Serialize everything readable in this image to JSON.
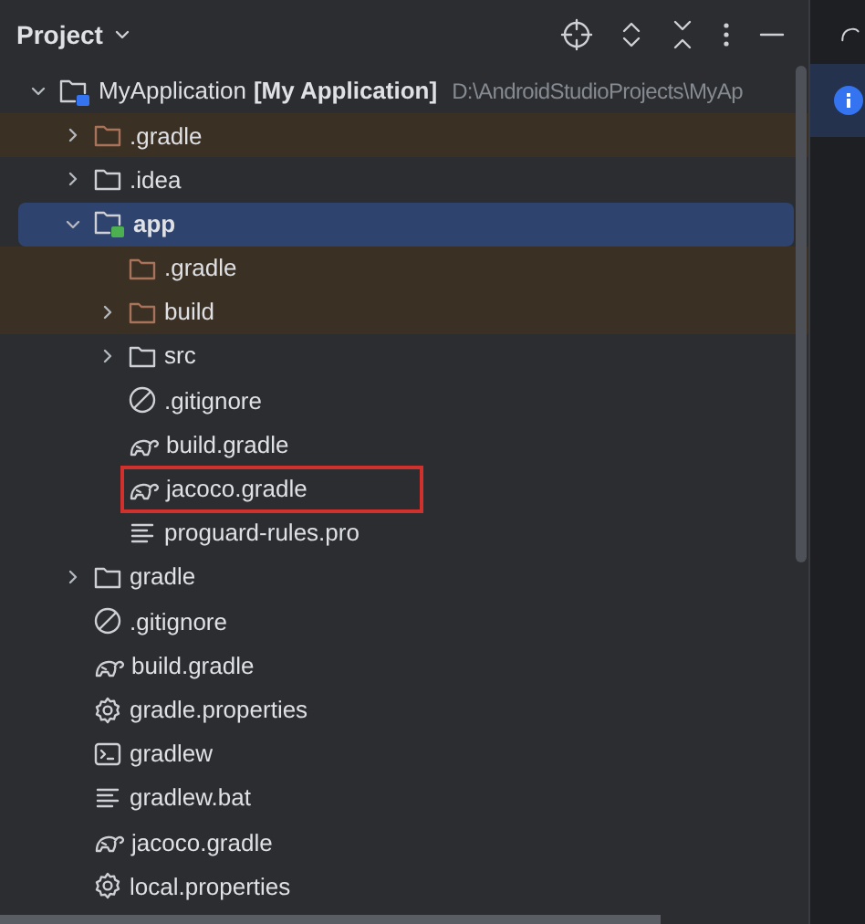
{
  "panel": {
    "title": "Project"
  },
  "tree": [
    {
      "name": "MyApplication",
      "module_label": "[My Application]",
      "path": "D:\\AndroidStudioProjects\\MyAp",
      "kind": "module",
      "color": "#3574f0",
      "expanded": true,
      "selected": false,
      "excluded": false,
      "marked": false,
      "children": [
        {
          "name": ".gradle",
          "kind": "folder",
          "expanded": false,
          "selected": false,
          "excluded": true,
          "marked": false
        },
        {
          "name": ".idea",
          "kind": "folder",
          "expanded": false,
          "selected": false,
          "excluded": false,
          "marked": false
        },
        {
          "name": "app",
          "kind": "module",
          "color": "#4caf50",
          "expanded": true,
          "selected": true,
          "excluded": false,
          "marked": false,
          "children": [
            {
              "name": ".gradle",
              "kind": "folder",
              "selected": false,
              "excluded": true,
              "marked": false
            },
            {
              "name": "build",
              "kind": "folder",
              "expanded": false,
              "selected": false,
              "excluded": true,
              "marked": false
            },
            {
              "name": "src",
              "kind": "folder",
              "expanded": false,
              "selected": false,
              "excluded": false,
              "marked": false
            },
            {
              "name": ".gitignore",
              "kind": "ignore",
              "selected": false,
              "excluded": false,
              "marked": false
            },
            {
              "name": "build.gradle",
              "kind": "gradle",
              "selected": false,
              "excluded": false,
              "marked": false
            },
            {
              "name": "jacoco.gradle",
              "kind": "gradle",
              "selected": false,
              "excluded": false,
              "marked": true
            },
            {
              "name": "proguard-rules.pro",
              "kind": "text",
              "selected": false,
              "excluded": false,
              "marked": false
            }
          ]
        },
        {
          "name": "gradle",
          "kind": "folder",
          "expanded": false,
          "selected": false,
          "excluded": false,
          "marked": false
        },
        {
          "name": ".gitignore",
          "kind": "ignore",
          "selected": false,
          "excluded": false,
          "marked": false
        },
        {
          "name": "build.gradle",
          "kind": "gradle",
          "selected": false,
          "excluded": false,
          "marked": false
        },
        {
          "name": "gradle.properties",
          "kind": "settings",
          "selected": false,
          "excluded": false,
          "marked": false
        },
        {
          "name": "gradlew",
          "kind": "terminal",
          "selected": false,
          "excluded": false,
          "marked": false
        },
        {
          "name": "gradlew.bat",
          "kind": "text",
          "selected": false,
          "excluded": false,
          "marked": false
        },
        {
          "name": "jacoco.gradle",
          "kind": "gradle",
          "selected": false,
          "excluded": false,
          "marked": false
        },
        {
          "name": "local.properties",
          "kind": "settings",
          "selected": false,
          "excluded": false,
          "marked": false
        }
      ]
    }
  ]
}
